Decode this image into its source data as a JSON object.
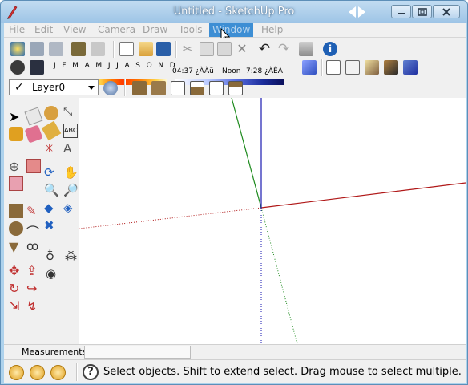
{
  "window": {
    "title": "Untitled - SketchUp Pro"
  },
  "menu": [
    {
      "label": "File"
    },
    {
      "label": "Edit"
    },
    {
      "label": "View"
    },
    {
      "label": "Camera"
    },
    {
      "label": "Draw"
    },
    {
      "label": "Tools"
    },
    {
      "label": "Window"
    },
    {
      "label": "Help"
    }
  ],
  "shadows": {
    "months": "J F M A M J J A S O N D",
    "time_start": "04:37 ¿ÀÀü",
    "time_noon": "Noon",
    "time_end": "7:28 ¿ÀÈÄ"
  },
  "layer": {
    "current": "Layer0"
  },
  "measurements": {
    "label": "Measurements",
    "value": ""
  },
  "status": {
    "text": "Select objects. Shift to extend select. Drag mouse to select multiple."
  },
  "colors": {
    "x_axis": "#b01818",
    "y_axis": "#1d8a1d",
    "z_axis": "#1a1ab0",
    "titlebar": "#aed2ec",
    "menu_highlight": "#3d8ed4"
  },
  "icons": {
    "toolbar_row1": [
      "new-model-icon",
      "open-icon",
      "save-icon",
      "cut-icon",
      "copy-icon",
      "paste-icon",
      "erase-icon",
      "undo-icon",
      "redo-icon",
      "print-icon",
      "model-info-icon"
    ],
    "toolbar_row2": [
      "shadow-toggle-icon",
      "shadow-settings-icon",
      "xray-icon",
      "wireframe-icon",
      "hidden-line-icon",
      "shaded-icon",
      "textured-icon",
      "monochrome-icon"
    ],
    "toolbar_row3": [
      "layer-manager-icon",
      "iso-view-icon",
      "front-view-icon",
      "top-view-icon",
      "right-view-icon",
      "back-view-icon",
      "left-view-icon"
    ]
  }
}
